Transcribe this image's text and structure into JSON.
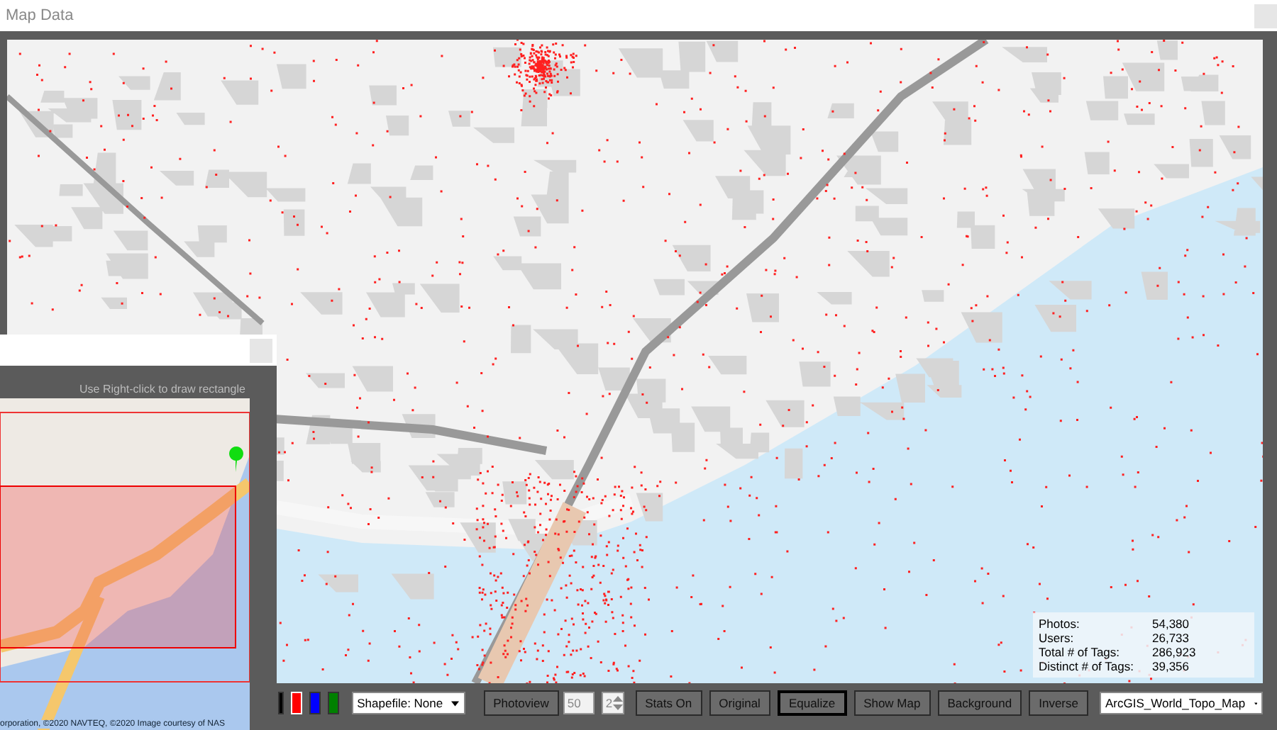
{
  "window": {
    "title": "Map Data"
  },
  "stats": [
    {
      "label": "Photos:",
      "value": "54,380"
    },
    {
      "label": "Users:",
      "value": "26,733"
    },
    {
      "label": "Total # of Tags:",
      "value": "286,923"
    },
    {
      "label": "Distinct # of Tags:",
      "value": "39,356"
    }
  ],
  "inset_window": {
    "hint": "Use Right-click to draw rectangle",
    "attribution": "orporation, ©2020 NAVTEQ, ©2020 Image courtesy of NAS"
  },
  "toolbar": {
    "swatches": [
      {
        "color": "#000000",
        "selected": false
      },
      {
        "color": "#ff0000",
        "selected": true
      },
      {
        "color": "#0000ff",
        "selected": false
      },
      {
        "color": "#008000",
        "selected": false
      }
    ],
    "shapefile": "Shapefile: None",
    "photoview": "Photoview",
    "count": "50",
    "step": "2",
    "buttons": [
      {
        "label": "Stats On",
        "focused": false
      },
      {
        "label": "Original",
        "focused": false
      },
      {
        "label": "Equalize",
        "focused": true
      },
      {
        "label": "Show Map",
        "focused": false
      },
      {
        "label": "Background",
        "focused": false
      },
      {
        "label": "Inverse",
        "focused": false
      }
    ],
    "basemap": "ArcGIS_World_Topo_Map"
  }
}
